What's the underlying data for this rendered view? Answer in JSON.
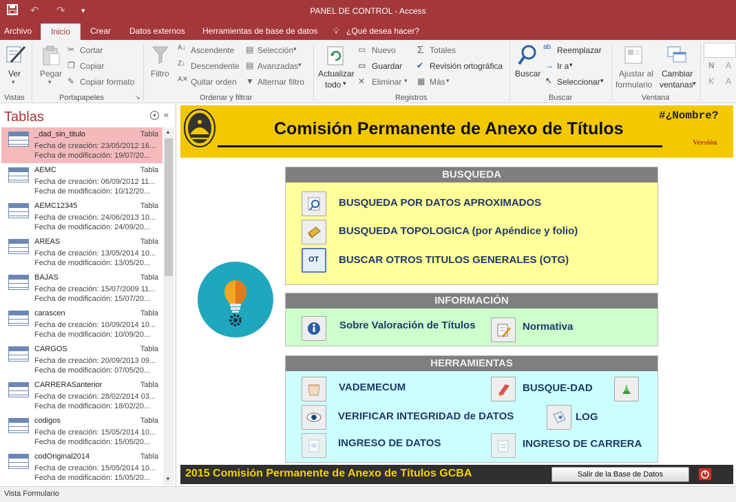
{
  "window": {
    "title": "PANEL DE CONTROL - Access"
  },
  "tabs": [
    "Archivo",
    "Inicio",
    "Crear",
    "Datos externos",
    "Herramientas de base de datos"
  ],
  "tell_me": "¿Qué desea hacer?",
  "ribbon": {
    "ver": "Ver",
    "pegar": "Pegar",
    "cortar": "Cortar",
    "copiar": "Copiar",
    "copiar_formato": "Copiar formato",
    "filtro": "Filtro",
    "ascendente": "Ascendente",
    "descendente": "Descendente",
    "quitar_orden": "Quitar orden",
    "seleccion": "Selección",
    "avanzadas": "Avanzadas",
    "alternar_filtro": "Alternar filtro",
    "actualizar": "Actualizar",
    "todo": "todo",
    "nuevo": "Nuevo",
    "guardar": "Guardar",
    "eliminar": "Eliminar",
    "totales": "Totales",
    "revision": "Revisión ortográfica",
    "mas": "Más",
    "buscar": "Buscar",
    "reemplazar": "Reemplazar",
    "ir_a": "Ir a",
    "seleccionar": "Seleccionar",
    "ajustar": "Ajustar al",
    "formulario": "formulario",
    "cambiar": "Cambiar",
    "ventanas": "ventanas",
    "groups": {
      "vistas": "Vistas",
      "portapapeles": "Portapapeles",
      "ordenar": "Ordenar y filtrar",
      "registros": "Registros",
      "buscar": "Buscar",
      "ventana": "Ventana"
    }
  },
  "nav": {
    "title": "Tablas",
    "items": [
      {
        "name": "_dad_sin_titulo",
        "type": "Tabla",
        "created": "Fecha de creación: 23/05/2012 16...",
        "modified": "Fecha de modificación: 19/07/20..."
      },
      {
        "name": "AEMC",
        "type": "Tabla",
        "created": "Fecha de creación: 06/09/2012 11...",
        "modified": "Fecha de modificación: 10/12/20..."
      },
      {
        "name": "AEMC12345",
        "type": "Tabla",
        "created": "Fecha de creación: 24/06/2013 10...",
        "modified": "Fecha de modificación: 24/09/20..."
      },
      {
        "name": "AREAS",
        "type": "Tabla",
        "created": "Fecha de creación: 13/05/2014 10...",
        "modified": "Fecha de modificación: 13/05/20..."
      },
      {
        "name": "BAJAS",
        "type": "Tabla",
        "created": "Fecha de creación: 15/07/2009 11...",
        "modified": "Fecha de modificación: 15/07/20..."
      },
      {
        "name": "carascen",
        "type": "Tabla",
        "created": "Fecha de creación: 10/09/2014 10...",
        "modified": "Fecha de modificación: 10/09/20..."
      },
      {
        "name": "CARGOS",
        "type": "Tabla",
        "created": "Fecha de creación: 20/09/2013 09...",
        "modified": "Fecha de modificación: 07/05/20..."
      },
      {
        "name": "CARRERASanterior",
        "type": "Tabla",
        "created": "Fecha de creación: 28/02/2014 03...",
        "modified": "Fecha de modificación: 18/02/20..."
      },
      {
        "name": "codigos",
        "type": "Tabla",
        "created": "Fecha de creación: 15/05/2014 10...",
        "modified": "Fecha de modificación: 15/05/20..."
      },
      {
        "name": "codOriginal2014",
        "type": "Tabla",
        "created": "Fecha de creación: 15/05/2014 10...",
        "modified": "Fecha de modificación: 15/05/20..."
      }
    ]
  },
  "form": {
    "title": "Comisión Permanente de Anexo de Títulos",
    "nombre": "#¿Nombre?",
    "version": "Versión",
    "busqueda": {
      "header": "BUSQUEDA",
      "btn1": "BUSQUEDA POR DATOS  APROXIMADOS",
      "btn2": "BUSQUEDA TOPOLOGICA (por Apéndice y folio)",
      "btn3": "BUSCAR  OTROS TITULOS GENERALES (OTG)",
      "ot": "OT"
    },
    "info": {
      "header": "INFORMACIÓN",
      "btn1": "Sobre Valoración de Títulos",
      "btn2": "Normativa"
    },
    "tools": {
      "header": "HERRAMIENTAS",
      "vademecum": "VADEMECUM",
      "busque": "BUSQUE-DAD",
      "verificar": "VERIFICAR INTEGRIDAD de DATOS",
      "log": "LOG",
      "ingreso": "INGRESO DE DATOS",
      "carrera": "INGRESO DE CARRERA"
    },
    "footer": "2015   Comisión Permanente de Anexo de Títulos GCBA",
    "exit": "Salir de la Base de Datos"
  },
  "status": "Vista Formulario",
  "colors": {
    "accent": "#a4373a",
    "header": "#f3c800",
    "busqueda": "#ffff99",
    "info": "#ccffcc",
    "tools": "#ccffff"
  }
}
